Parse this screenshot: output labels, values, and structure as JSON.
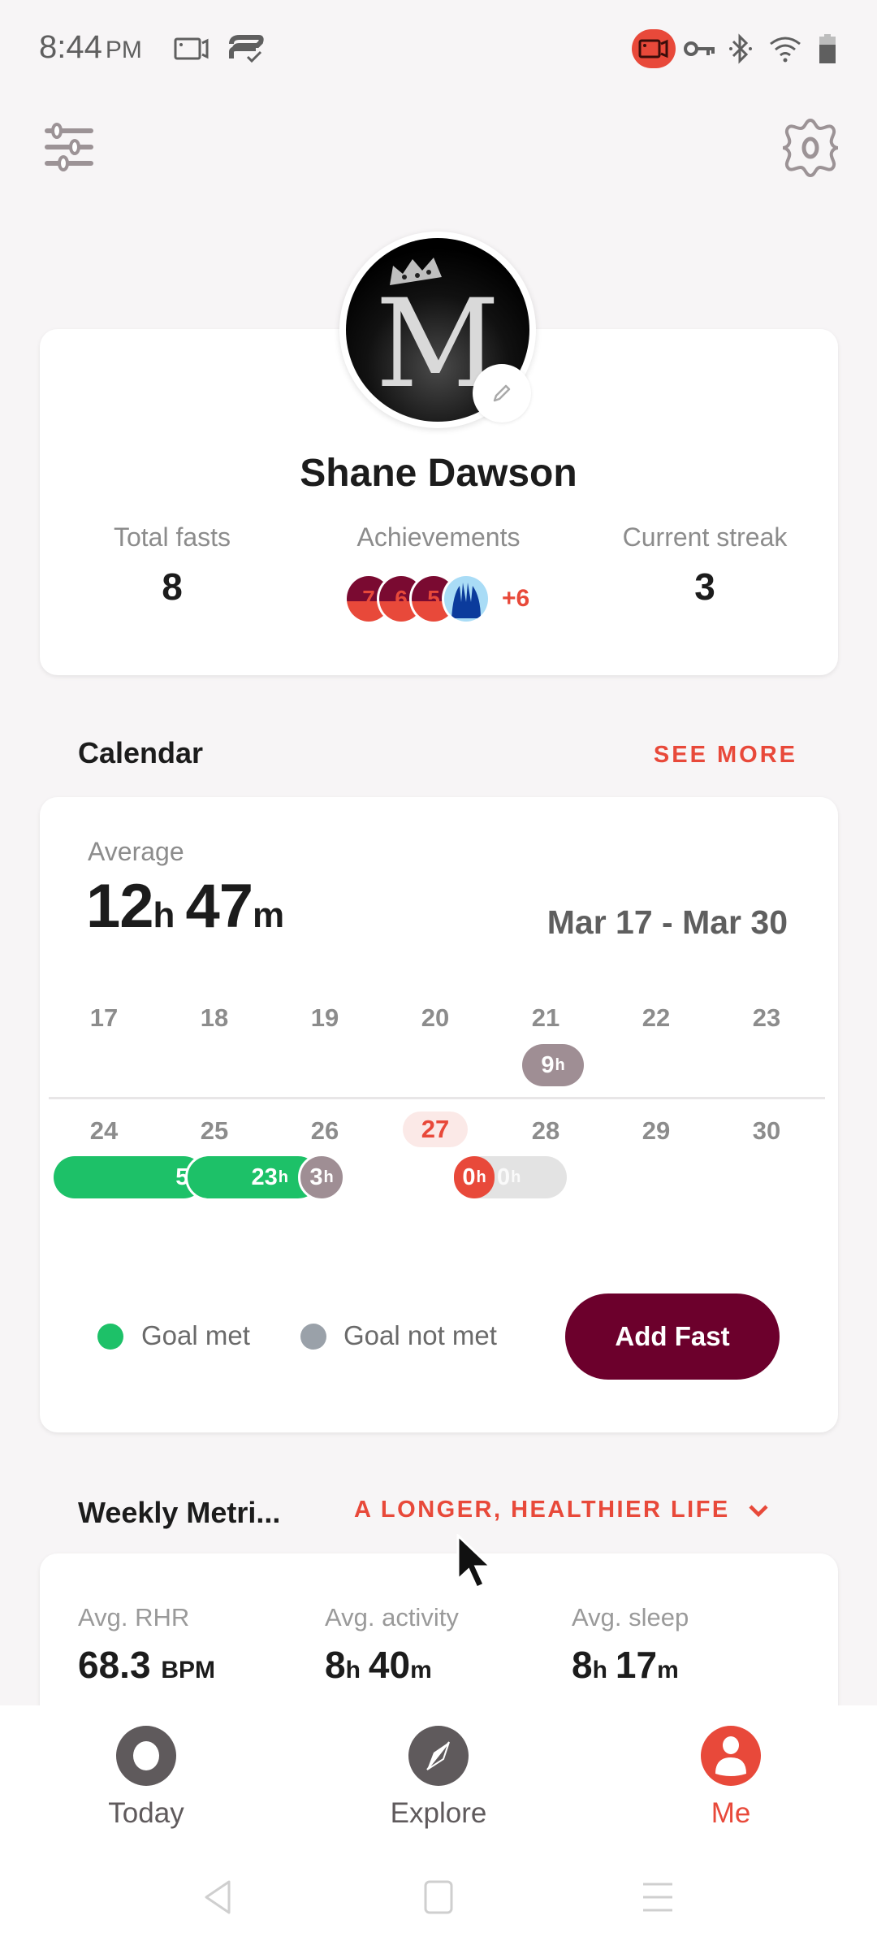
{
  "status_bar": {
    "time": "8:44",
    "ampm": "PM",
    "left_icons": [
      "screen-record-icon",
      "cast-check-icon"
    ],
    "right_icons": [
      "recording-indicator-icon",
      "vpn-key-icon",
      "bluetooth-icon",
      "wifi-icon",
      "battery-icon"
    ]
  },
  "header": {
    "left_icon": "filter-sliders-icon",
    "right_icon": "settings-gear-icon"
  },
  "profile": {
    "name": "Shane Dawson",
    "avatar_letter": "M",
    "stats": {
      "total_fasts_label": "Total fasts",
      "total_fasts_value": "8",
      "achievements_label": "Achievements",
      "current_streak_label": "Current streak",
      "current_streak_value": "3"
    },
    "achievement_badges": [
      {
        "label": "7",
        "type": "number"
      },
      {
        "label": "6",
        "type": "number"
      },
      {
        "label": "5",
        "type": "number"
      },
      {
        "label": "",
        "type": "fork-hand"
      }
    ],
    "achievements_more": "+6"
  },
  "calendar": {
    "title": "Calendar",
    "see_more": "SEE MORE",
    "average_label": "Average",
    "average_hours": "12",
    "average_hours_unit": "h",
    "average_minutes": "47",
    "average_minutes_unit": "m",
    "date_range": "Mar 17 - Mar 30",
    "week1": [
      "17",
      "18",
      "19",
      "20",
      "21",
      "22",
      "23"
    ],
    "week2": [
      "24",
      "25",
      "26",
      "27",
      "28",
      "29",
      "30"
    ],
    "today": "27",
    "fasts": [
      {
        "day": "21",
        "value": "9",
        "unit": "h",
        "status": "goal-not-met"
      },
      {
        "day": "24",
        "value": "5",
        "unit": "",
        "status": "goal-met"
      },
      {
        "day": "25",
        "value": "23",
        "unit": "h",
        "status": "goal-met"
      },
      {
        "day": "26",
        "value": "3",
        "unit": "h",
        "status": "goal-not-met"
      },
      {
        "day": "27",
        "value": "0",
        "unit": "h",
        "status": "in-progress"
      },
      {
        "day": "28",
        "value": "0",
        "unit": "h",
        "status": "planned"
      }
    ],
    "legend": {
      "goal_met": "Goal met",
      "goal_not_met": "Goal not met"
    },
    "add_fast": "Add Fast",
    "colors": {
      "goal_met": "#1dc168",
      "goal_not_met": "#9f8e94",
      "in_progress": "#e8493a",
      "button": "#6c002c"
    }
  },
  "weekly_metrics": {
    "title": "Weekly Metri...",
    "goal_dropdown": "A LONGER, HEALTHIER LIFE",
    "metrics": [
      {
        "label": "Avg. RHR",
        "value": "68.3",
        "unit": "BPM"
      },
      {
        "label": "Avg. activity",
        "hours": "8",
        "h": "h",
        "minutes": "40",
        "m": "m"
      },
      {
        "label": "Avg. sleep",
        "hours": "8",
        "h": "h",
        "minutes": "17",
        "m": "m"
      }
    ]
  },
  "bottom_nav": {
    "items": [
      {
        "label": "Today",
        "icon": "today-ring-icon",
        "active": false
      },
      {
        "label": "Explore",
        "icon": "compass-icon",
        "active": false
      },
      {
        "label": "Me",
        "icon": "profile-icon",
        "active": true
      }
    ]
  },
  "system_nav": [
    "back-icon",
    "home-icon",
    "recents-icon"
  ],
  "accent_color": "#e8493a"
}
